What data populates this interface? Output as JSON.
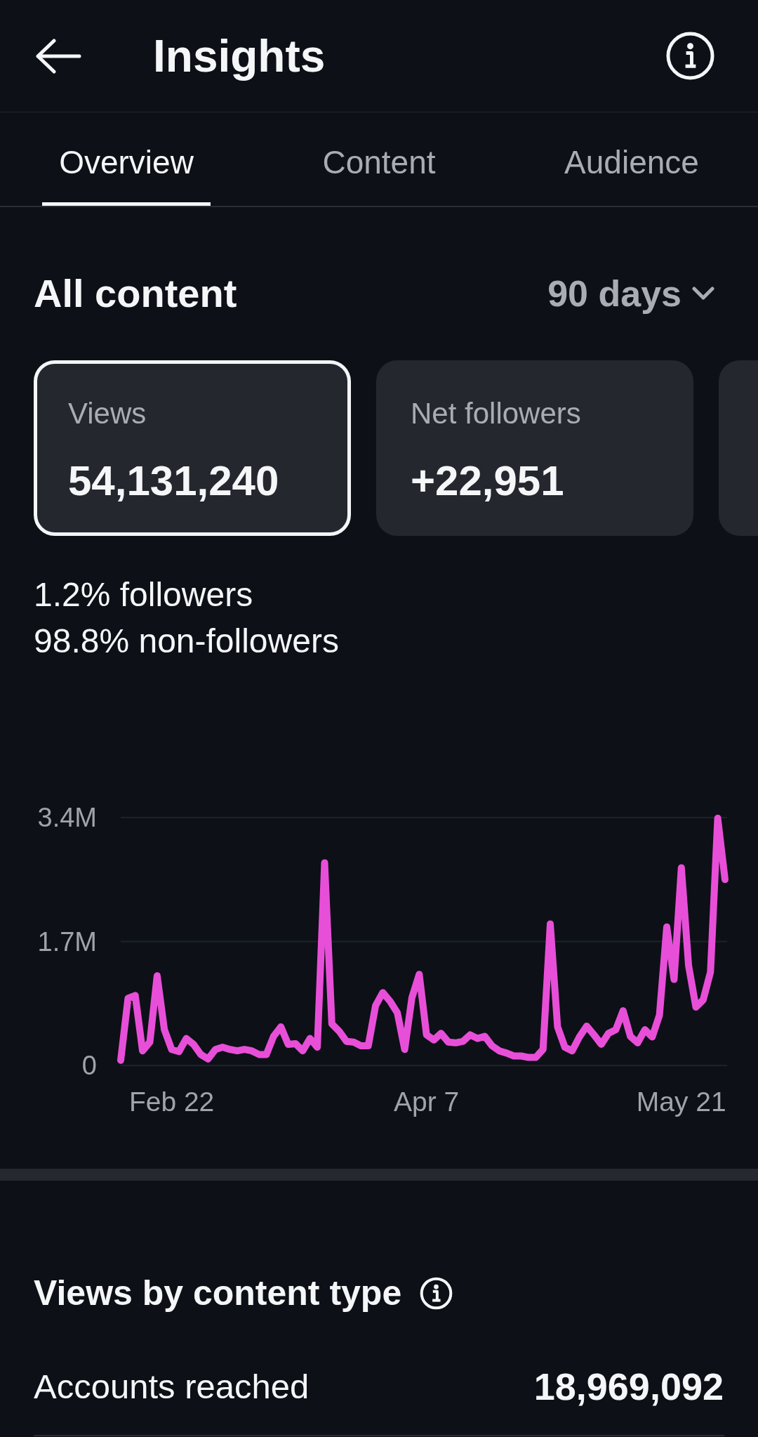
{
  "header": {
    "title": "Insights"
  },
  "tabs": [
    {
      "label": "Overview",
      "selected": true
    },
    {
      "label": "Content",
      "selected": false
    },
    {
      "label": "Audience",
      "selected": false
    }
  ],
  "summary": {
    "title": "All content",
    "period": "90 days",
    "cards": [
      {
        "label": "Views",
        "value": "54,131,240",
        "selected": true
      },
      {
        "label": "Net followers",
        "value": "+22,951",
        "selected": false
      },
      {
        "selected": false
      }
    ],
    "breakdown": [
      "1.2% followers",
      "98.8% non-followers"
    ],
    "chart_data": {
      "type": "line",
      "categories": [
        null,
        null,
        null,
        null,
        null,
        null,
        null,
        "Feb 22",
        null,
        null,
        null,
        null,
        null,
        null,
        null,
        null,
        null,
        null,
        null,
        null,
        null,
        null,
        null,
        null,
        null,
        null,
        null,
        null,
        null,
        null,
        null,
        null,
        null,
        null,
        null,
        null,
        null,
        null,
        null,
        null,
        null,
        null,
        "Apr 7",
        null,
        null,
        null,
        null,
        null,
        null,
        null,
        null,
        null,
        null,
        null,
        null,
        null,
        null,
        null,
        null,
        null,
        null,
        null,
        null,
        null,
        null,
        null,
        null,
        null,
        null,
        null,
        null,
        null,
        null,
        null,
        null,
        null,
        null,
        "May 21",
        null,
        null,
        null,
        null,
        null,
        null
      ],
      "series": [
        {
          "color": "#e84fd8",
          "values": [
            0.07,
            0.92,
            0.96,
            0.2,
            0.32,
            1.23,
            0.49,
            0.22,
            0.19,
            0.37,
            0.29,
            0.15,
            0.09,
            0.22,
            0.25,
            0.22,
            0.2,
            0.22,
            0.2,
            0.15,
            0.15,
            0.4,
            0.53,
            0.29,
            0.3,
            0.2,
            0.37,
            0.25,
            2.78,
            0.57,
            0.47,
            0.33,
            0.32,
            0.27,
            0.27,
            0.82,
            1.0,
            0.88,
            0.72,
            0.22,
            0.93,
            1.25,
            0.42,
            0.35,
            0.44,
            0.32,
            0.31,
            0.33,
            0.42,
            0.37,
            0.4,
            0.27,
            0.2,
            0.17,
            0.13,
            0.13,
            0.11,
            0.11,
            0.22,
            1.94,
            0.53,
            0.25,
            0.2,
            0.39,
            0.54,
            0.42,
            0.29,
            0.44,
            0.49,
            0.75,
            0.4,
            0.31,
            0.49,
            0.39,
            0.69,
            1.9,
            1.18,
            2.71,
            1.37,
            0.8,
            0.9,
            1.28,
            3.39,
            2.55
          ]
        }
      ],
      "ylim": [
        0,
        3.4
      ],
      "yticks": [
        {
          "value": 0,
          "label": "0"
        },
        {
          "value": 1.7,
          "label": "1.7M"
        },
        {
          "value": 3.4,
          "label": "3.4M"
        }
      ]
    }
  },
  "content_type": {
    "title": "Views by content type",
    "rows": [
      {
        "label": "Accounts reached",
        "value": "18,969,092"
      }
    ]
  }
}
